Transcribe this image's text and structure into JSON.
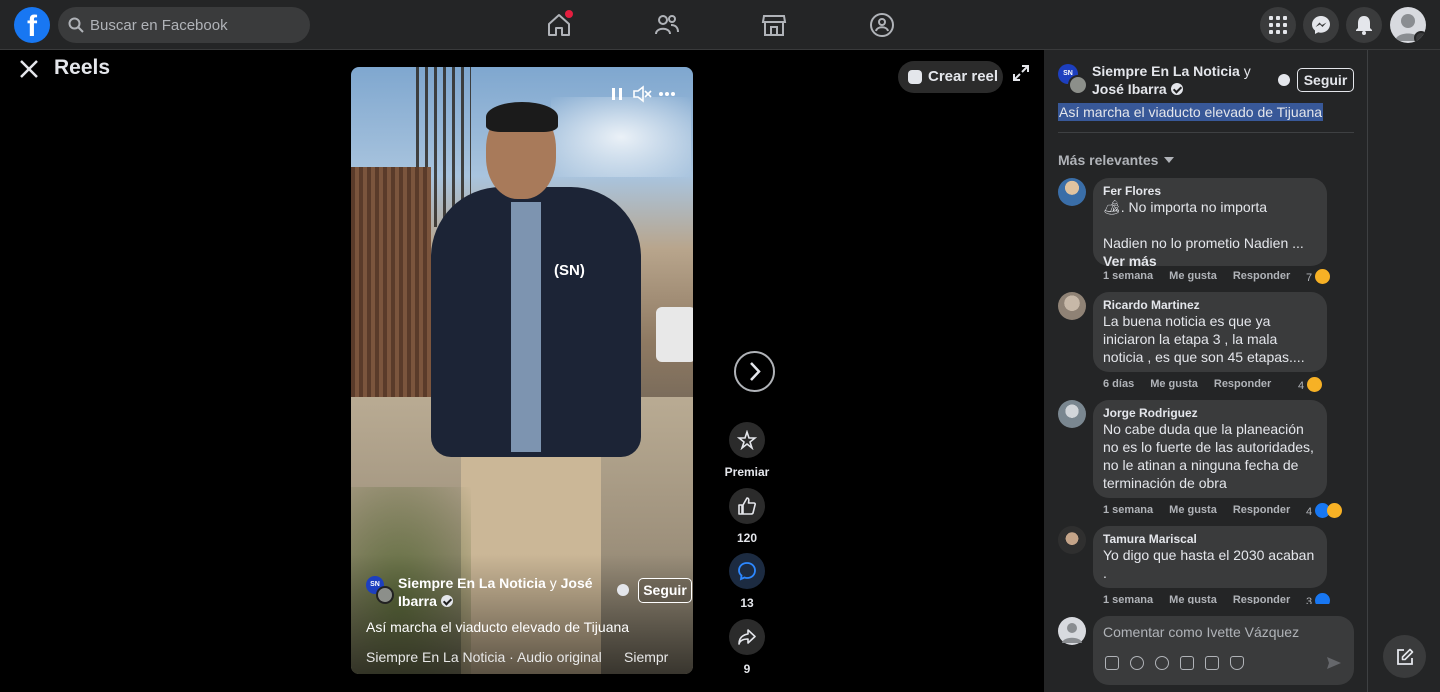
{
  "header": {
    "search_placeholder": "Buscar en Facebook",
    "logo_letter": "f",
    "icons": [
      "home-icon",
      "friends-icon",
      "marketplace-icon",
      "groups-icon",
      "menu-grid-icon",
      "messenger-icon",
      "notifications-icon",
      "avatar"
    ]
  },
  "reels": {
    "title": "Reels",
    "create_label": "Crear reel",
    "video": {
      "page_initials": "SN",
      "author_primary": "Siempre En La Noticia",
      "author_joiner": "y",
      "author_secondary": "José Ibarra",
      "follow_label": "Seguir",
      "caption": "Así marcha el viaducto elevado de Tijuana",
      "audio_text": "Siempre En La Noticia · Audio original",
      "audio_next": "Siempr",
      "overlay_logo": "(SN)"
    },
    "actions": {
      "premiar": "Premiar",
      "likes": "120",
      "comments": "13",
      "shares": "9"
    }
  },
  "panel": {
    "page_initials": "SN",
    "author_primary": "Siempre En La Noticia",
    "author_joiner": "y",
    "author_secondary": "José Ibarra",
    "follow_label": "Seguir",
    "caption": "Así marcha el viaducto elevado de Tijuana",
    "sort_label": "Más relevantes",
    "comments": [
      {
        "author": "Fer Flores",
        "text": "🏕. No importa no importa\n\nNadien no lo prometio Nadien ...",
        "more": "Ver más",
        "time": "1 semana",
        "like": "Me gusta",
        "reply": "Responder",
        "reactions": "7"
      },
      {
        "author": "Ricardo Martinez",
        "text": "La buena noticia es que ya\niniciaron la etapa 3 , la mala\nnoticia , es que son 45 etapas....",
        "time": "6 días",
        "like": "Me gusta",
        "reply": "Responder",
        "reactions": "4"
      },
      {
        "author": "Jorge Rodriguez",
        "text": "No cabe duda que la planeación\nno es lo fuerte de las autoridades,\nno le atinan a ninguna fecha de\nterminación de obra",
        "time": "1 semana",
        "like": "Me gusta",
        "reply": "Responder",
        "reactions": "4"
      },
      {
        "author": "Tamura Mariscal",
        "text": "Yo digo que hasta el 2030 acaban\n.",
        "time": "1 semana",
        "like": "Me gusta",
        "reply": "Responder",
        "reactions": "3"
      }
    ],
    "compose_placeholder": "Comentar como Ivette Vázquez"
  },
  "colors": {
    "brand": "#1877f2",
    "topbar": "#242526",
    "panel": "#242526",
    "bubble": "#3a3b3c",
    "notification_dot": "#e41e3f"
  }
}
